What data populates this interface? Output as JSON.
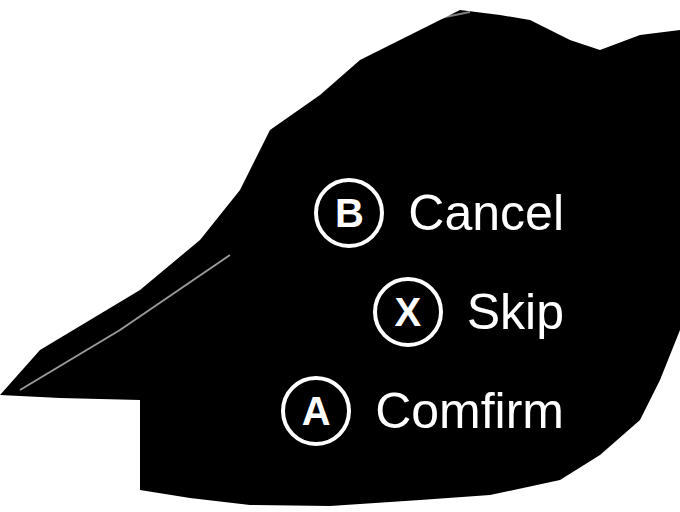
{
  "prompts": [
    {
      "key": "B",
      "label": "Cancel"
    },
    {
      "key": "X",
      "label": "Skip"
    },
    {
      "key": "A",
      "label": "Comfirm"
    }
  ]
}
